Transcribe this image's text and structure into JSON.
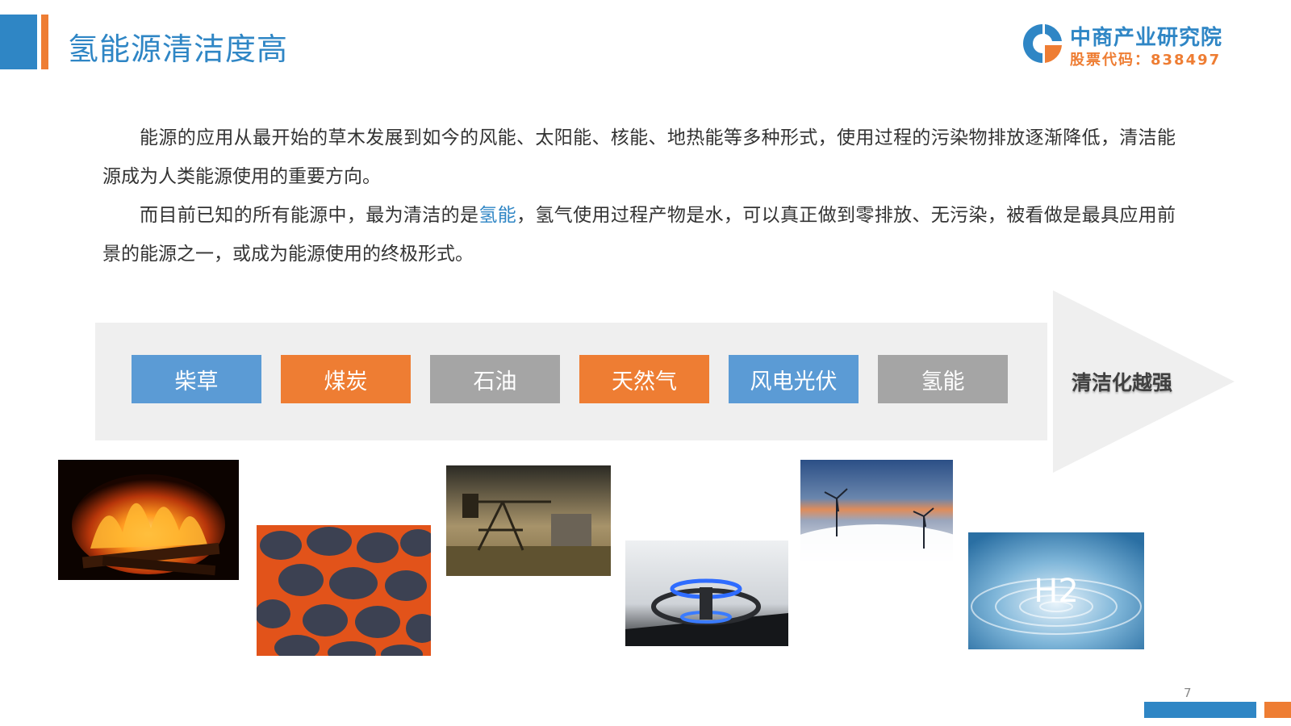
{
  "header": {
    "title": "氢能源清洁度高",
    "logo_name": "中商产业研究院",
    "logo_code": "股票代码：838497"
  },
  "body": {
    "p1": "能源的应用从最开始的草木发展到如今的风能、太阳能、核能、地热能等多种形式，使用过程的污染物排放逐渐降低，清洁能源成为人类能源使用的重要方向。",
    "p2_before": "而目前已知的所有能源中，最为清洁的是",
    "p2_highlight": "氢能",
    "p2_after": "，氢气使用过程产物是水，可以真正做到零排放、无污染，被看做是最具应用前景的能源之一，或成为能源使用的终极形式。"
  },
  "stages": [
    {
      "label": "柴草",
      "color": "#5b9bd5"
    },
    {
      "label": "煤炭",
      "color": "#ee7d33"
    },
    {
      "label": "石油",
      "color": "#a5a5a5"
    },
    {
      "label": "天然气",
      "color": "#ee7d33"
    },
    {
      "label": "风电光伏",
      "color": "#5b9bd5"
    },
    {
      "label": "氢能",
      "color": "#a5a5a5"
    }
  ],
  "arrow_label": "清洁化越强",
  "photos": {
    "h2_text": "H2"
  },
  "footer": {
    "page_number": "7"
  },
  "colors": {
    "brand_blue": "#2f86c5",
    "brand_orange": "#ee7d33",
    "band_gray": "#efefef"
  }
}
